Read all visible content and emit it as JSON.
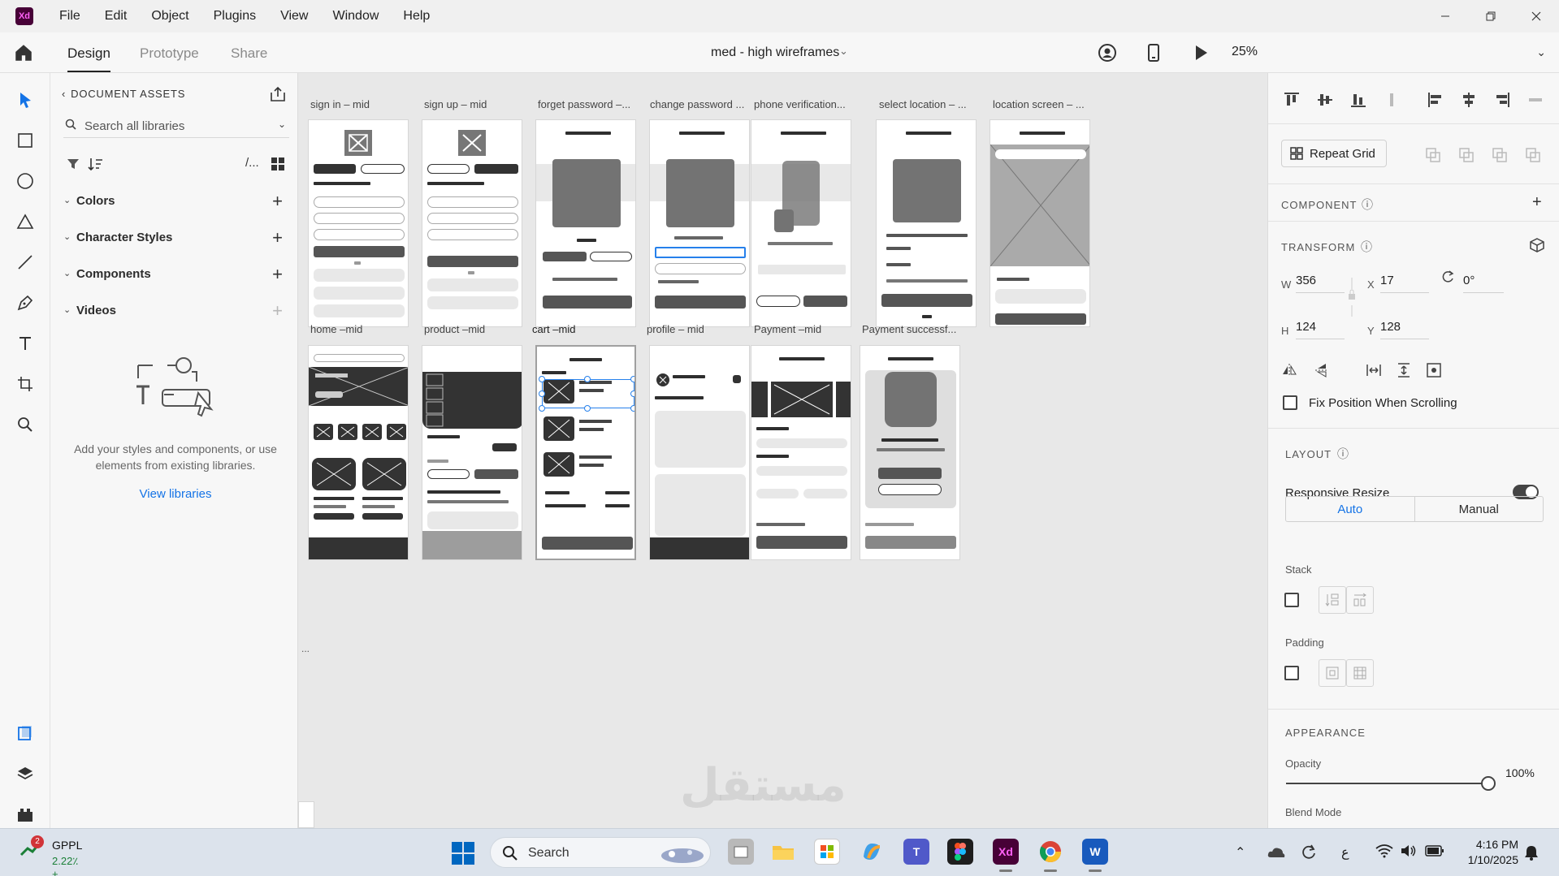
{
  "app": {
    "logo_text": "Xd",
    "menus": [
      "File",
      "Edit",
      "Object",
      "Plugins",
      "View",
      "Window",
      "Help"
    ],
    "window_controls": [
      "minimize",
      "restore",
      "close"
    ]
  },
  "toolbar": {
    "tabs": [
      {
        "label": "Design",
        "active": true
      },
      {
        "label": "Prototype",
        "active": false
      },
      {
        "label": "Share",
        "active": false
      }
    ],
    "document_title": "med - high wireframes",
    "zoom": "25%"
  },
  "tools": [
    "select-icon",
    "rectangle-icon",
    "ellipse-icon",
    "polygon-icon",
    "line-icon",
    "pen-icon",
    "text-icon",
    "artboard-icon",
    "zoom-icon"
  ],
  "bottom_tools": [
    "assets-icon",
    "layers-icon",
    "plugins-icon"
  ],
  "assets": {
    "header": "DOCUMENT ASSETS",
    "search_placeholder": "Search all libraries",
    "filter_more": "/...",
    "sections": [
      {
        "label": "Colors",
        "plus_enabled": true
      },
      {
        "label": "Character Styles",
        "plus_enabled": true
      },
      {
        "label": "Components",
        "plus_enabled": true
      },
      {
        "label": "Videos",
        "plus_enabled": false
      }
    ],
    "empty_text": "Add your styles and components, or use elements from existing libraries.",
    "view_libraries": "View libraries"
  },
  "canvas": {
    "artboards_row1": [
      "sign in – mid",
      "sign up – mid",
      "forget password –...",
      "change password ...",
      "phone verification...",
      "select location – ...",
      "location screen – ..."
    ],
    "artboards_row2": [
      "home –mid",
      "product –mid",
      "cart –mid",
      "profile – mid",
      "Payment –mid",
      "Payment  successf..."
    ],
    "selected_artboard": "cart –mid",
    "ellipsis": "...",
    "watermark": "مستقل"
  },
  "inspector": {
    "repeat_grid": "Repeat Grid",
    "component_label": "COMPONENT",
    "transform_label": "TRANSFORM",
    "w_label": "W",
    "w": "356",
    "x_label": "X",
    "x": "17",
    "h_label": "H",
    "h": "124",
    "y_label": "Y",
    "y": "128",
    "rotation": "0°",
    "fix_position": "Fix Position When Scrolling",
    "layout_label": "LAYOUT",
    "responsive_resize": "Responsive Resize",
    "responsive_on": true,
    "auto": "Auto",
    "manual": "Manual",
    "stack": "Stack",
    "padding": "Padding",
    "appearance_label": "APPEARANCE",
    "opacity_label": "Opacity",
    "opacity": "100%",
    "blend_mode": "Blend Mode"
  },
  "taskbar": {
    "stock_badge": "2",
    "stock_name": "GPPL",
    "stock_change": "2.22٪+",
    "search": "Search",
    "tray_lang": "ع",
    "time": "4:16 PM",
    "date": "1/10/2025"
  },
  "colors": {
    "accent_blue": "#1473e6",
    "selection_blue": "#2680eb",
    "xd_brand": "#470137",
    "xd_pink": "#ff61f6"
  }
}
